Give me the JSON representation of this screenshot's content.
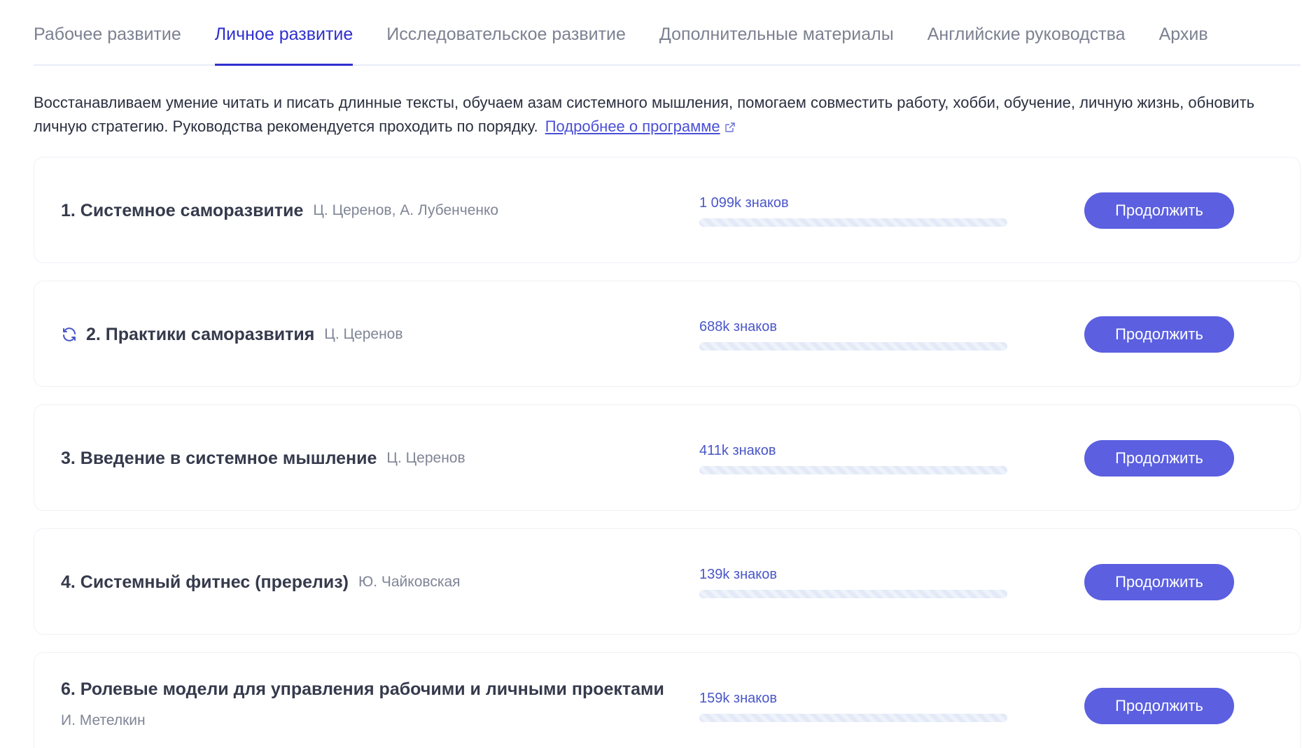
{
  "tabs": [
    {
      "label": "Рабочее развитие",
      "active": false
    },
    {
      "label": "Личное развитие",
      "active": true
    },
    {
      "label": "Исследовательское развитие",
      "active": false
    },
    {
      "label": "Дополнительные материалы",
      "active": false
    },
    {
      "label": "Английские руководства",
      "active": false
    },
    {
      "label": "Архив",
      "active": false
    }
  ],
  "intro": {
    "text": "Восстанавливаем умение читать и писать длинные тексты, обучаем азам системного мышления, помогаем совместить работу, хобби, обучение, личную жизнь, обновить личную стратегию. Руководства рекомендуется проходить по порядку.",
    "link": "Подробнее о программе",
    "link_icon": "external-link-icon"
  },
  "guides": [
    {
      "title": "1. Системное саморазвитие",
      "author": "Ц. Церенов, А. Лубенченко",
      "chars": "1 099k знаков",
      "progress": 0,
      "button": "Продолжить",
      "sync": false
    },
    {
      "title": "2. Практики саморазвития",
      "author": "Ц. Церенов",
      "chars": "688k знаков",
      "progress": 0,
      "button": "Продолжить",
      "sync": true
    },
    {
      "title": "3. Введение в системное мышление",
      "author": "Ц. Церенов",
      "chars": "411k знаков",
      "progress": 0,
      "button": "Продолжить",
      "sync": false
    },
    {
      "title": "4. Системный фитнес (пререлиз)",
      "author": "Ю. Чайковская",
      "chars": "139k знаков",
      "progress": 0,
      "button": "Продолжить",
      "sync": false
    },
    {
      "title": "6. Ролевые модели для управления рабочими и личными проектами",
      "author": "И. Метелкин",
      "chars": "159k знаков",
      "progress": 0,
      "button": "Продолжить",
      "sync": false
    }
  ],
  "colors": {
    "accent": "#5b5fe0",
    "active_tab": "#2f2fd0",
    "chars_text": "#4a56c8"
  },
  "icons": {
    "sync": "sync-icon",
    "menu": "more-vertical-icon"
  }
}
